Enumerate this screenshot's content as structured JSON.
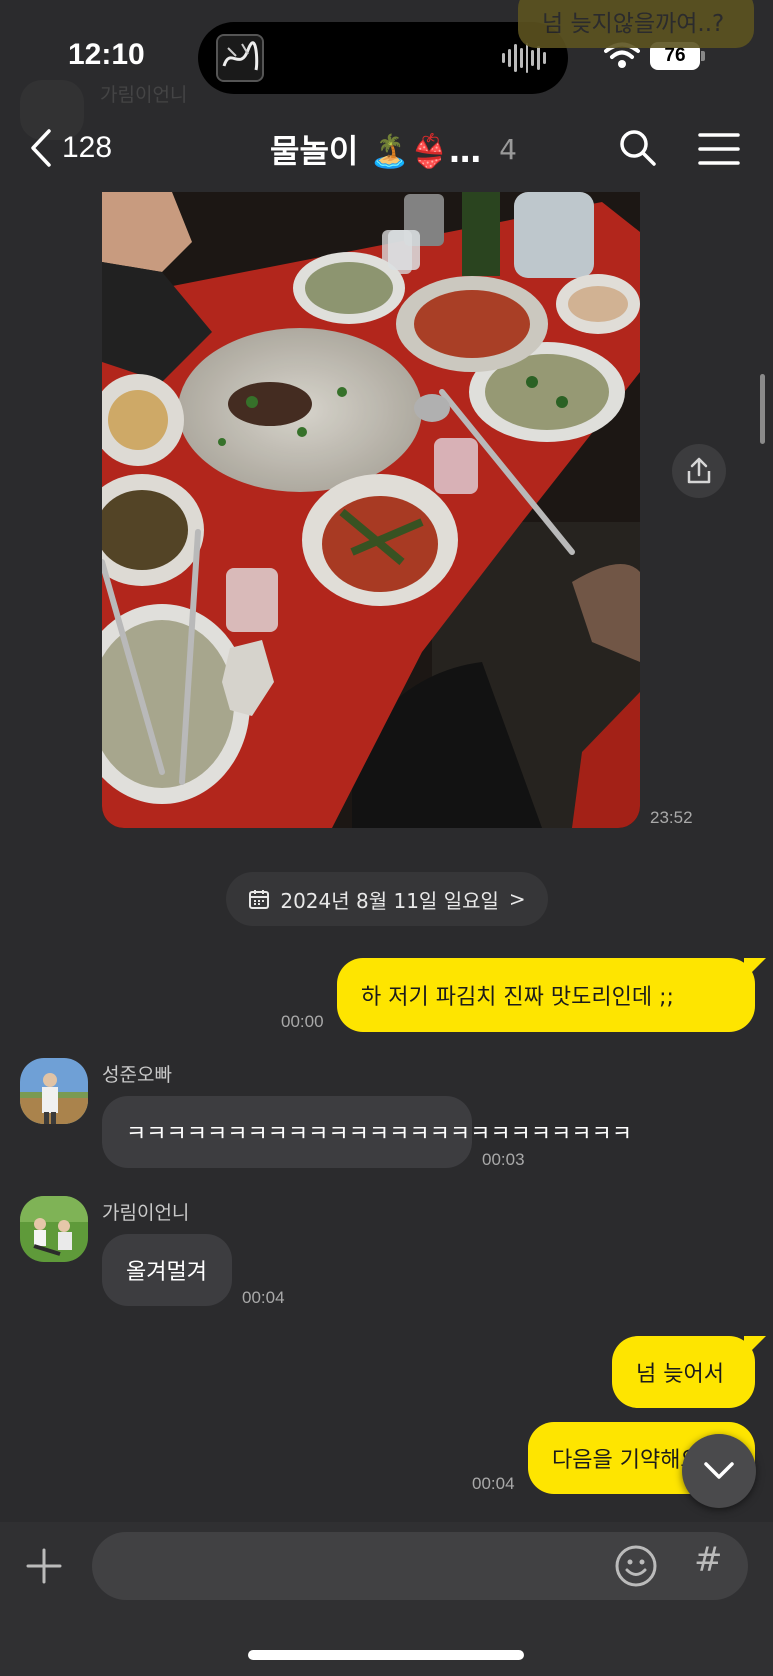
{
  "status_bar": {
    "time": "12:10",
    "battery": "76"
  },
  "ghost_preview": {
    "text": "넘 늦지않을까여..?",
    "name": "가림이언니"
  },
  "header": {
    "back_count": "128",
    "title": "물놀이 🏝️👙…",
    "member_count": "4"
  },
  "photo_message": {
    "time": "23:52"
  },
  "date_divider": {
    "label": "2024년 8월 11일 일요일",
    "chevron": ">"
  },
  "messages": [
    {
      "from": "me",
      "text": "하 저기 파김치 진짜 맛도리인데 ;;",
      "time": "00:00"
    },
    {
      "from": "성준오빠",
      "text": "ㅋㅋㅋㅋㅋㅋㅋㅋㅋㅋㅋㅋㅋㅋㅋㅋㅋㅋㅋㅋㅋㅋㅋㅋㅋ",
      "time": "00:03"
    },
    {
      "from": "가림이언니",
      "text": "올겨멀겨",
      "time": "00:04"
    },
    {
      "from": "me",
      "text": "넘 늦어서",
      "time": ""
    },
    {
      "from": "me",
      "text": "다음을 기약해요",
      "time": "00:04"
    }
  ],
  "senders": {
    "s1": "성준오빠",
    "s2": "가림이언니"
  },
  "input": {
    "placeholder": "",
    "value": ""
  },
  "icons": {
    "back": "chevron-left-icon",
    "search": "search-icon",
    "menu": "menu-icon",
    "share": "share-icon",
    "calendar": "calendar-icon",
    "scroll_down": "chevron-down-icon",
    "plus": "plus-icon",
    "emoji": "emoji-icon",
    "hash": "#"
  },
  "colors": {
    "background": "#2b2b2d",
    "my_bubble": "#fee500",
    "their_bubble": "#3d3d40"
  }
}
